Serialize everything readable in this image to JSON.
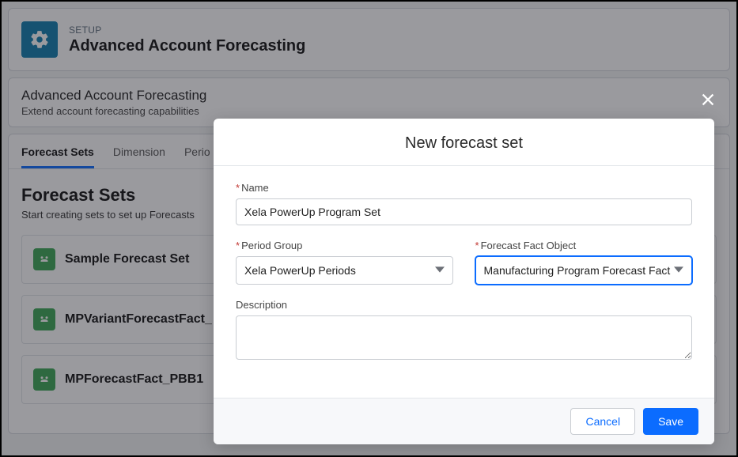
{
  "header": {
    "eyebrow": "SETUP",
    "title": "Advanced Account Forecasting"
  },
  "sub": {
    "title": "Advanced Account Forecasting",
    "desc": "Extend account forecasting capabilities"
  },
  "tabs": [
    {
      "label": "Forecast Sets",
      "active": true
    },
    {
      "label": "Dimension",
      "active": false
    },
    {
      "label": "Perio",
      "active": false
    }
  ],
  "section": {
    "title": "Forecast Sets",
    "help": "Start creating sets to set up Forecasts"
  },
  "sets": [
    {
      "name": "Sample Forecast Set"
    },
    {
      "name": "MPVariantForecastFact_"
    },
    {
      "name": "MPForecastFact_PBB1"
    }
  ],
  "modal": {
    "title": "New forecast set",
    "name_label": "Name",
    "name_value": "Xela PowerUp Program Set",
    "period_label": "Period Group",
    "period_value": "Xela PowerUp Periods",
    "fact_label": "Forecast Fact Object",
    "fact_value": "Manufacturing Program Forecast Fact",
    "desc_label": "Description",
    "desc_value": "",
    "cancel": "Cancel",
    "save": "Save"
  }
}
